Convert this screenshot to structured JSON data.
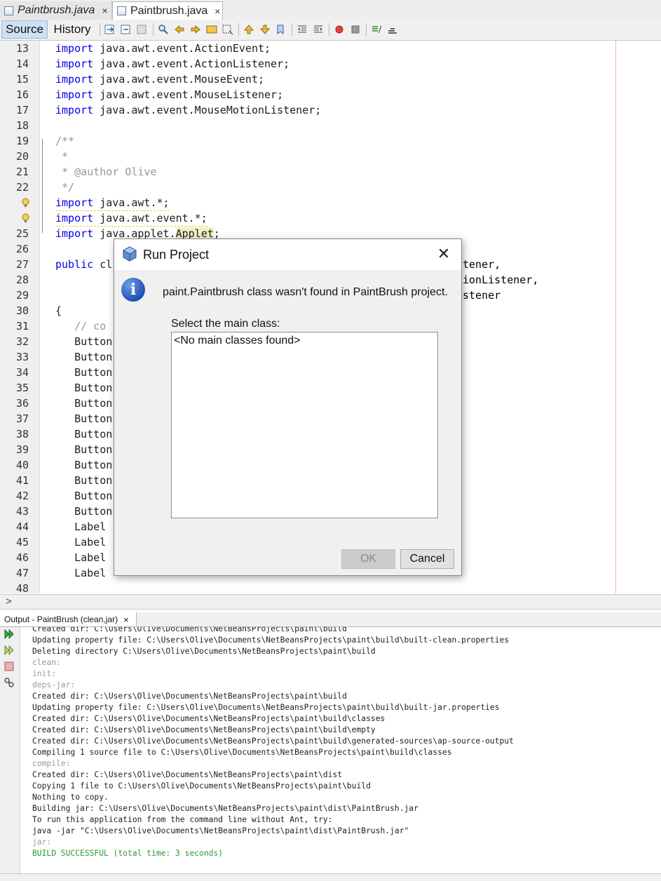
{
  "tabs": [
    {
      "label": "Paintbrush.java",
      "close": "×"
    },
    {
      "label": "Paintbrush.java",
      "close": "×"
    }
  ],
  "toolbar": {
    "source": "Source",
    "history": "History"
  },
  "editor": {
    "lines": [
      {
        "n": "13",
        "code": "import java.awt.event.ActionEvent;"
      },
      {
        "n": "14",
        "code": "import java.awt.event.ActionListener;"
      },
      {
        "n": "15",
        "code": "import java.awt.event.MouseEvent;"
      },
      {
        "n": "16",
        "code": "import java.awt.event.MouseListener;"
      },
      {
        "n": "17",
        "code": "import java.awt.event.MouseMotionListener;"
      },
      {
        "n": "18",
        "code": ""
      },
      {
        "n": "19",
        "code": "/**"
      },
      {
        "n": "20",
        "code": " *"
      },
      {
        "n": "21",
        "code": " * @author Olive"
      },
      {
        "n": "22",
        "code": " */"
      },
      {
        "n": "",
        "code": "import java.awt.*;"
      },
      {
        "n": "",
        "code": "import java.awt.event.*;"
      },
      {
        "n": "25",
        "code": "import java.applet.Applet;"
      },
      {
        "n": "26",
        "code": ""
      },
      {
        "n": "27",
        "code": "public cl"
      },
      {
        "n": "28",
        "code": ""
      },
      {
        "n": "29",
        "code": ""
      },
      {
        "n": "30",
        "code": "{"
      },
      {
        "n": "31",
        "code": "   // co"
      },
      {
        "n": "32",
        "code": "   Button"
      },
      {
        "n": "33",
        "code": "   Button"
      },
      {
        "n": "34",
        "code": "   Button"
      },
      {
        "n": "35",
        "code": "   Button"
      },
      {
        "n": "36",
        "code": "   Button"
      },
      {
        "n": "37",
        "code": "   Button"
      },
      {
        "n": "38",
        "code": "   Button"
      },
      {
        "n": "39",
        "code": "   Button"
      },
      {
        "n": "40",
        "code": "   Button"
      },
      {
        "n": "41",
        "code": "   Button"
      },
      {
        "n": "42",
        "code": "   Button"
      },
      {
        "n": "43",
        "code": "   Button"
      },
      {
        "n": "44",
        "code": "   Label"
      },
      {
        "n": "45",
        "code": "   Label"
      },
      {
        "n": "46",
        "code": "   Label"
      },
      {
        "n": "47",
        "code": "   Label"
      },
      {
        "n": "48",
        "code": ""
      }
    ],
    "right_fragments": {
      "l27": "tener,",
      "l28": "ionListener,",
      "l29": "stener"
    }
  },
  "dialog": {
    "title": "Run Project",
    "close": "✕",
    "message": "paint.Paintbrush class wasn't found in PaintBrush project.",
    "select_label": "Select the main class:",
    "list_item": "<No main classes found>",
    "ok": "OK",
    "cancel": "Cancel"
  },
  "output": {
    "tab_label": "Output - PaintBrush (clean,jar)",
    "tab_close": "×",
    "lines": [
      {
        "t": "Created dir: C:\\Users\\Olive\\Documents\\NetBeansProjects\\paint\\build",
        "s": "n"
      },
      {
        "t": "Updating property file: C:\\Users\\Olive\\Documents\\NetBeansProjects\\paint\\build\\built-clean.properties",
        "s": "n"
      },
      {
        "t": "Deleting directory C:\\Users\\Olive\\Documents\\NetBeansProjects\\paint\\build",
        "s": "n"
      },
      {
        "t": "clean:",
        "s": "dim"
      },
      {
        "t": "init:",
        "s": "dim"
      },
      {
        "t": "deps-jar:",
        "s": "dim"
      },
      {
        "t": "Created dir: C:\\Users\\Olive\\Documents\\NetBeansProjects\\paint\\build",
        "s": "n"
      },
      {
        "t": "Updating property file: C:\\Users\\Olive\\Documents\\NetBeansProjects\\paint\\build\\built-jar.properties",
        "s": "n"
      },
      {
        "t": "Created dir: C:\\Users\\Olive\\Documents\\NetBeansProjects\\paint\\build\\classes",
        "s": "n"
      },
      {
        "t": "Created dir: C:\\Users\\Olive\\Documents\\NetBeansProjects\\paint\\build\\empty",
        "s": "n"
      },
      {
        "t": "Created dir: C:\\Users\\Olive\\Documents\\NetBeansProjects\\paint\\build\\generated-sources\\ap-source-output",
        "s": "n"
      },
      {
        "t": "Compiling 1 source file to C:\\Users\\Olive\\Documents\\NetBeansProjects\\paint\\build\\classes",
        "s": "n"
      },
      {
        "t": "compile:",
        "s": "dim"
      },
      {
        "t": "Created dir: C:\\Users\\Olive\\Documents\\NetBeansProjects\\paint\\dist",
        "s": "n"
      },
      {
        "t": "Copying 1 file to C:\\Users\\Olive\\Documents\\NetBeansProjects\\paint\\build",
        "s": "n"
      },
      {
        "t": "Nothing to copy.",
        "s": "n"
      },
      {
        "t": "Building jar: C:\\Users\\Olive\\Documents\\NetBeansProjects\\paint\\dist\\PaintBrush.jar",
        "s": "n"
      },
      {
        "t": "To run this application from the command line without Ant, try:",
        "s": "n"
      },
      {
        "t": "java -jar \"C:\\Users\\Olive\\Documents\\NetBeansProjects\\paint\\dist\\PaintBrush.jar\"",
        "s": "n"
      },
      {
        "t": "jar:",
        "s": "dim"
      },
      {
        "t": "BUILD SUCCESSFUL (total time: 3 seconds)",
        "s": "ok"
      }
    ]
  },
  "colors": {
    "keyword": "#0000e6",
    "comment": "#969696",
    "success": "#2a9a2a",
    "source_tab": "#cfe0f5"
  }
}
